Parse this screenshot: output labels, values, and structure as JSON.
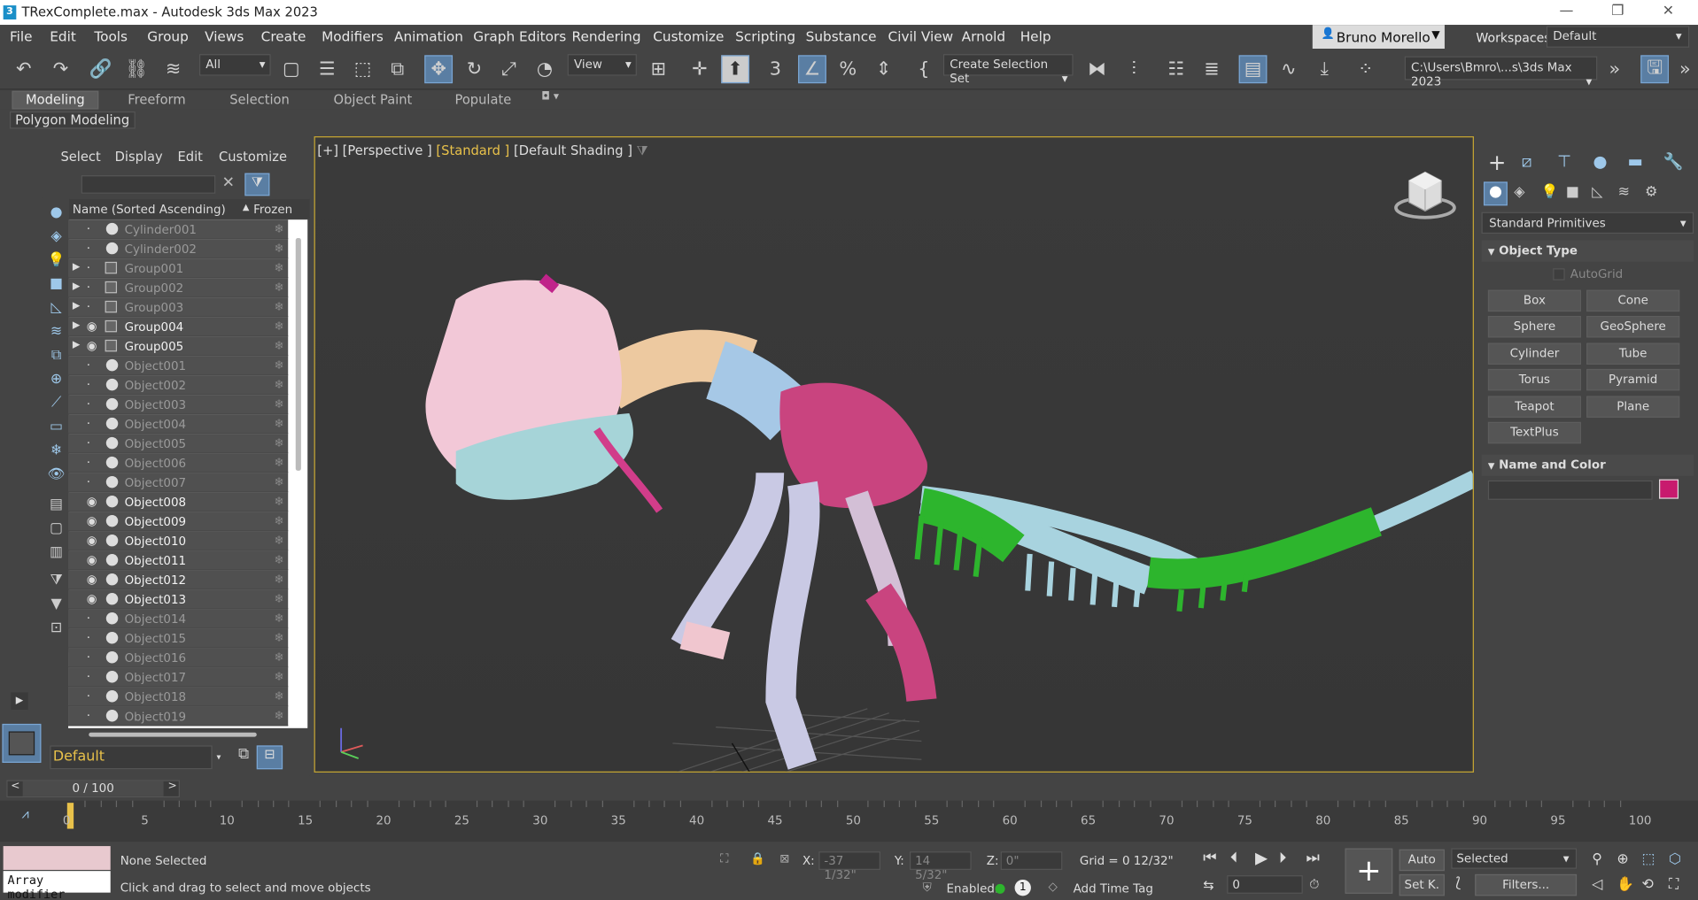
{
  "window": {
    "title": "TRexComplete.max - Autodesk 3ds Max 2023",
    "app_icon": "3"
  },
  "menu": [
    "File",
    "Edit",
    "Tools",
    "Group",
    "Views",
    "Create",
    "Modifiers",
    "Animation",
    "Graph Editors",
    "Rendering",
    "Customize",
    "Scripting",
    "Substance",
    "Civil View",
    "Arnold",
    "Help"
  ],
  "user": {
    "name": "Bruno Morello"
  },
  "workspaces": {
    "label": "Workspaces:",
    "value": "Default"
  },
  "toolbar": {
    "filter_value": "All",
    "ref_coord": "View",
    "selection_set": "Create Selection Set",
    "project_path": "C:\\Users\\Bmro\\...s\\3ds Max 2023"
  },
  "ribbon": {
    "tabs": [
      "Modeling",
      "Freeform",
      "Selection",
      "Object Paint",
      "Populate"
    ],
    "subtitle": "Polygon Modeling"
  },
  "scene_explorer": {
    "menu": [
      "Select",
      "Display",
      "Edit",
      "Customize"
    ],
    "col_name": "Name (Sorted Ascending)",
    "col_frozen": "Frozen",
    "sort_arrow": "▲",
    "layer": "Default",
    "rows": [
      {
        "name": "Cylinder001",
        "visible": false,
        "type": "object",
        "expand": false
      },
      {
        "name": "Cylinder002",
        "visible": false,
        "type": "object",
        "expand": false
      },
      {
        "name": "Group001",
        "visible": false,
        "type": "group",
        "expand": true
      },
      {
        "name": "Group002",
        "visible": false,
        "type": "group",
        "expand": true
      },
      {
        "name": "Group003",
        "visible": false,
        "type": "group",
        "expand": true
      },
      {
        "name": "Group004",
        "visible": true,
        "type": "group",
        "expand": true
      },
      {
        "name": "Group005",
        "visible": true,
        "type": "group",
        "expand": true
      },
      {
        "name": "Object001",
        "visible": false,
        "type": "object",
        "expand": false
      },
      {
        "name": "Object002",
        "visible": false,
        "type": "object",
        "expand": false
      },
      {
        "name": "Object003",
        "visible": false,
        "type": "object",
        "expand": false
      },
      {
        "name": "Object004",
        "visible": false,
        "type": "object",
        "expand": false
      },
      {
        "name": "Object005",
        "visible": false,
        "type": "object",
        "expand": false
      },
      {
        "name": "Object006",
        "visible": false,
        "type": "object",
        "expand": false
      },
      {
        "name": "Object007",
        "visible": false,
        "type": "object",
        "expand": false
      },
      {
        "name": "Object008",
        "visible": true,
        "type": "object",
        "expand": false
      },
      {
        "name": "Object009",
        "visible": true,
        "type": "object",
        "expand": false
      },
      {
        "name": "Object010",
        "visible": true,
        "type": "object",
        "expand": false
      },
      {
        "name": "Object011",
        "visible": true,
        "type": "object",
        "expand": false
      },
      {
        "name": "Object012",
        "visible": true,
        "type": "object",
        "expand": false
      },
      {
        "name": "Object013",
        "visible": true,
        "type": "object",
        "expand": false
      },
      {
        "name": "Object014",
        "visible": false,
        "type": "object",
        "expand": false
      },
      {
        "name": "Object015",
        "visible": false,
        "type": "object",
        "expand": false
      },
      {
        "name": "Object016",
        "visible": false,
        "type": "object",
        "expand": false
      },
      {
        "name": "Object017",
        "visible": false,
        "type": "object",
        "expand": false
      },
      {
        "name": "Object018",
        "visible": false,
        "type": "object",
        "expand": false
      },
      {
        "name": "Object019",
        "visible": false,
        "type": "object",
        "expand": false
      }
    ]
  },
  "viewport": {
    "labels": [
      "[+]",
      "[Perspective ]",
      "[Standard ]",
      "[Default Shading ]"
    ],
    "standard_color": "#e8c14a",
    "border_color": "#c7a632"
  },
  "command_panel": {
    "category": "Standard Primitives",
    "object_type_title": "Object Type",
    "autogrid": "AutoGrid",
    "buttons": [
      "Box",
      "Cone",
      "Sphere",
      "GeoSphere",
      "Cylinder",
      "Tube",
      "Torus",
      "Pyramid",
      "Teapot",
      "Plane",
      "TextPlus"
    ],
    "name_color_title": "Name and Color",
    "swatch_color": "#c81a6e"
  },
  "timeline": {
    "frame_display": "0 / 100",
    "ticks": [
      "0",
      "5",
      "10",
      "15",
      "20",
      "25",
      "30",
      "35",
      "40",
      "45",
      "50",
      "55",
      "60",
      "65",
      "70",
      "75",
      "80",
      "85",
      "90",
      "95",
      "100"
    ]
  },
  "status": {
    "maxscript": "Array modifier",
    "selection": "None Selected",
    "prompt": "Click and drag to select and move objects",
    "x_label": "X:",
    "x_value": "-37 1/32\"",
    "y_label": "Y:",
    "y_value": "14 5/32\"",
    "z_label": "Z:",
    "z_value": "0\"",
    "grid": "Grid = 0 12/32\"",
    "enabled": "Enabled:",
    "enabled_num": "1",
    "add_time_tag": "Add Time Tag",
    "auto": "Auto",
    "set_key": "Set K.",
    "key_mode": "Selected",
    "filters": "Filters...",
    "frame": "0"
  }
}
